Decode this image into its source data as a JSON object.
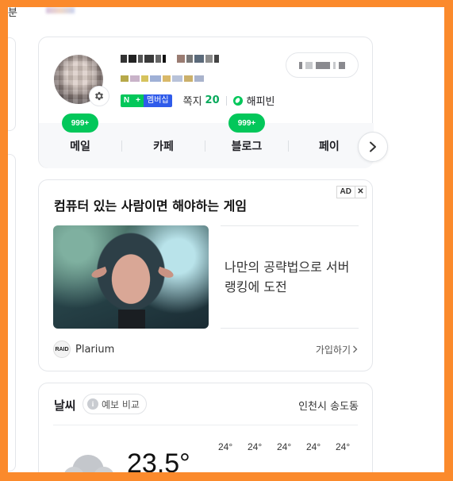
{
  "top_strip": {
    "prev_text": "분"
  },
  "profile": {
    "membership_n": "N",
    "membership_plus": "+",
    "membership_label": "멤버십",
    "mail_label": "쪽지",
    "mail_count": "20",
    "happybean_label": "해피빈",
    "services": [
      {
        "label": "메일",
        "badge": "999+"
      },
      {
        "label": "카페",
        "badge": ""
      },
      {
        "label": "블로그",
        "badge": "999+"
      },
      {
        "label": "페이",
        "badge": ""
      }
    ]
  },
  "ad": {
    "badge": "AD",
    "close": "✕",
    "title": "컴퓨터 있는 사람이면 해야하는 게임",
    "description": "나만의 공략법으로 서버랭킹에 도전",
    "brand_logo_text": "RAID",
    "brand_name": "Plarium",
    "cta": "가입하기"
  },
  "weather": {
    "title": "날씨",
    "forecast_compare": "예보 비교",
    "location": "인천시 송도동",
    "current_temp": "23.5°",
    "hourly": [
      "24°",
      "24°",
      "24°",
      "24°",
      "24°"
    ]
  },
  "colors": {
    "accent_green": "#03c75a",
    "frame_orange": "#fb8a2c",
    "membership_blue": "#2f5bea"
  }
}
